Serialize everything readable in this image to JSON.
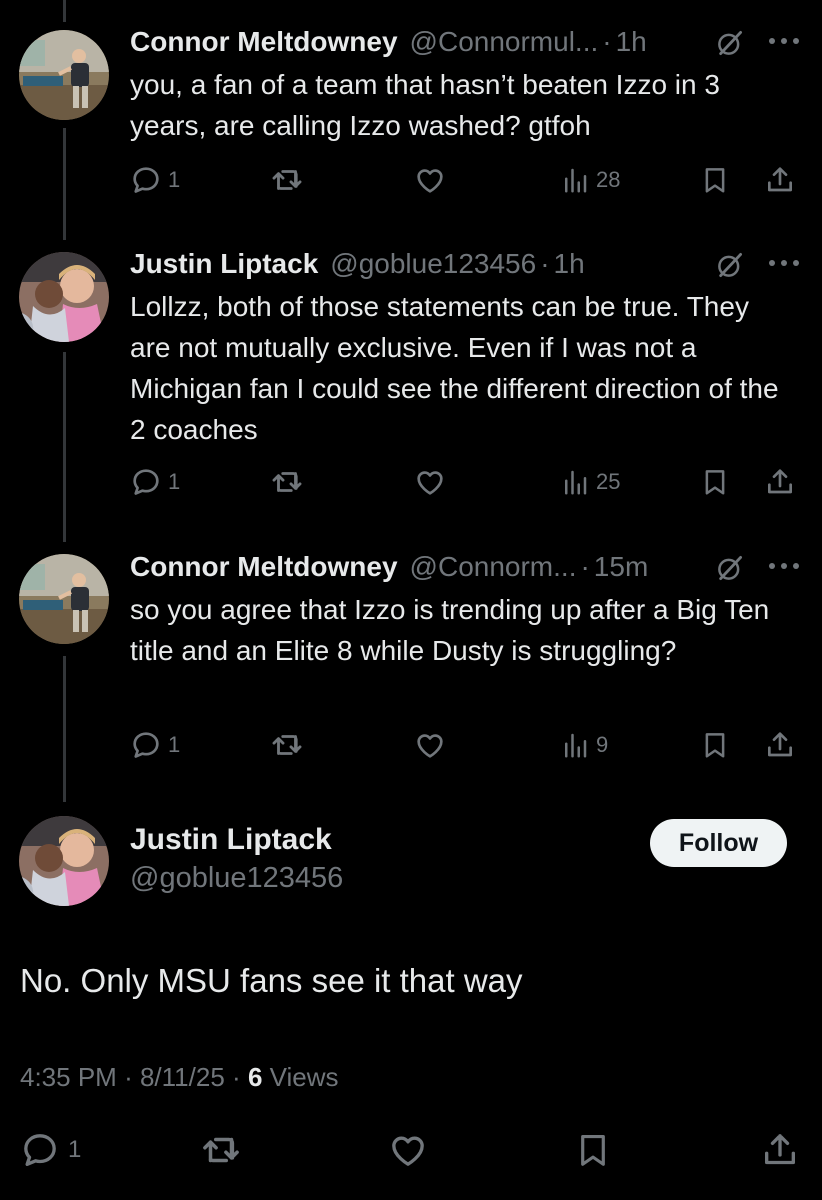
{
  "replies": [
    {
      "name": "Connor Meltdowney",
      "handle": "@Connormul...",
      "time": "1h",
      "text": "you, a fan of a team that hasn’t beaten Izzo in 3 years, are calling Izzo washed? gtfoh",
      "replies_count": "1",
      "views": "28"
    },
    {
      "name": "Justin Liptack",
      "handle": "@goblue123456",
      "time": "1h",
      "text": "Lollzz, both of those statements can be true. They are not mutually exclusive.  Even if I was not a Michigan fan I could see the different direction of the 2 coaches",
      "replies_count": "1",
      "views": "25"
    },
    {
      "name": "Connor Meltdowney",
      "handle": "@Connorm...",
      "time": "15m",
      "text": "so you agree that Izzo is trending up after a Big Ten title and an Elite 8 while Dusty is struggling?",
      "replies_count": "1",
      "views": "9"
    }
  ],
  "main": {
    "name": "Justin Liptack",
    "handle": "@goblue123456",
    "follow_label": "Follow",
    "text": "No.  Only MSU fans see it that way",
    "timestamp": "4:35 PM",
    "date": "8/11/25",
    "views_count": "6",
    "views_label": "Views",
    "replies_count": "1"
  },
  "separator": "·",
  "colors": {
    "background": "#000000",
    "text": "#e7e9ea",
    "muted": "#71767b",
    "follow_bg": "#eff3f4"
  },
  "icons": [
    "reply-icon",
    "repost-icon",
    "like-icon",
    "views-icon",
    "bookmark-icon",
    "share-icon",
    "grok-icon",
    "more-icon"
  ]
}
